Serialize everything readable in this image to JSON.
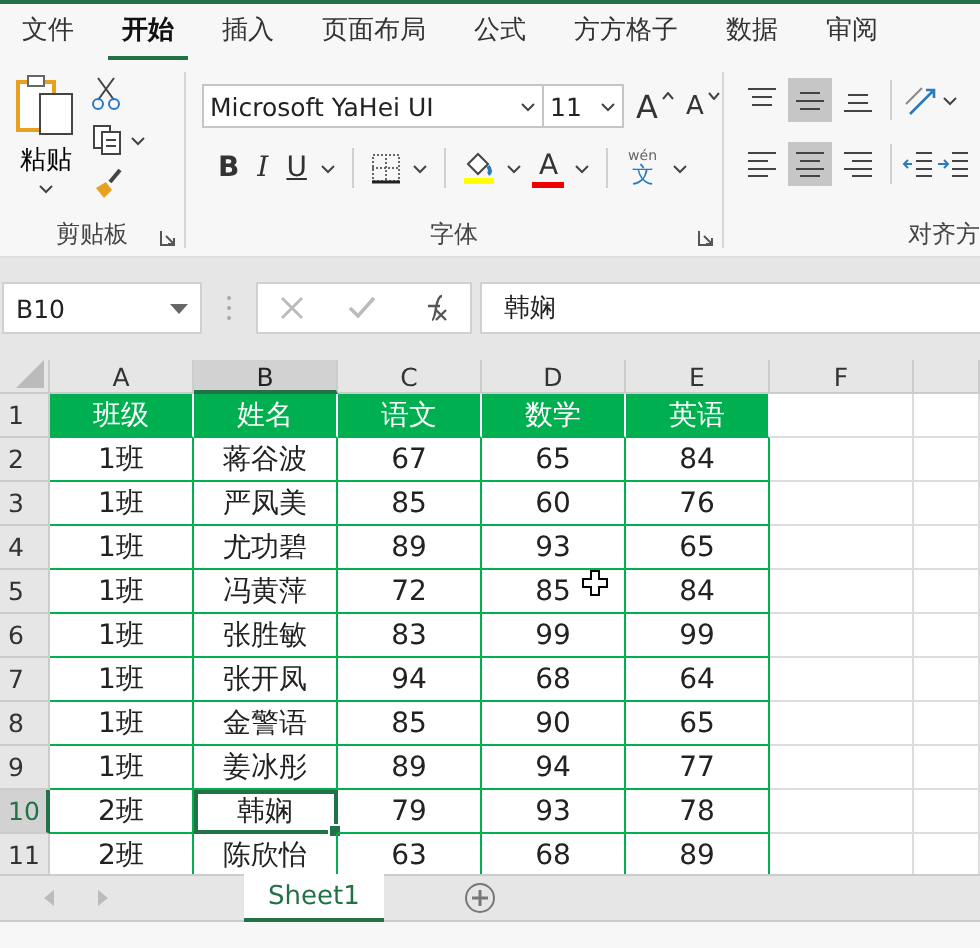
{
  "tabs": [
    {
      "label": "文件",
      "selected": false
    },
    {
      "label": "开始",
      "selected": true
    },
    {
      "label": "插入",
      "selected": false
    },
    {
      "label": "页面布局",
      "selected": false
    },
    {
      "label": "公式",
      "selected": false
    },
    {
      "label": "方方格子",
      "selected": false
    },
    {
      "label": "数据",
      "selected": false
    },
    {
      "label": "审阅",
      "selected": false
    }
  ],
  "clipboard": {
    "paste_label": "粘贴",
    "group_label": "剪贴板"
  },
  "font": {
    "name": "Microsoft YaHei UI",
    "size": "11",
    "grow_label": "A",
    "shrink_label": "A",
    "bold_label": "B",
    "italic_label": "I",
    "underline_label": "U",
    "font_color_label": "A",
    "phonetic_top": "wén",
    "phonetic_main": "文",
    "group_label": "字体"
  },
  "alignment": {
    "group_label": "对齐方",
    "vertical_buttons": [
      {
        "kind": "top",
        "selected": false
      },
      {
        "kind": "middle",
        "selected": true
      },
      {
        "kind": "bottom",
        "selected": false
      }
    ],
    "horizontal_buttons": [
      {
        "kind": "left",
        "selected": false
      },
      {
        "kind": "center",
        "selected": true
      },
      {
        "kind": "right",
        "selected": false
      }
    ]
  },
  "formula_bar": {
    "name_box": "B10",
    "value": "韩娴"
  },
  "sheet": {
    "columns": [
      {
        "label": "A",
        "selected": false
      },
      {
        "label": "B",
        "selected": true
      },
      {
        "label": "C",
        "selected": false
      },
      {
        "label": "D",
        "selected": false
      },
      {
        "label": "E",
        "selected": false
      },
      {
        "label": "F",
        "selected": false
      }
    ],
    "rows": [
      {
        "number": "1",
        "kind": "header",
        "selected": false,
        "cells": [
          "班级",
          "姓名",
          "语文",
          "数学",
          "英语"
        ]
      },
      {
        "number": "2",
        "kind": "data",
        "selected": false,
        "cells": [
          "1班",
          "蒋谷波",
          "67",
          "65",
          "84"
        ]
      },
      {
        "number": "3",
        "kind": "data",
        "selected": false,
        "cells": [
          "1班",
          "严凤美",
          "85",
          "60",
          "76"
        ]
      },
      {
        "number": "4",
        "kind": "data",
        "selected": false,
        "cells": [
          "1班",
          "尤功碧",
          "89",
          "93",
          "65"
        ]
      },
      {
        "number": "5",
        "kind": "data",
        "selected": false,
        "cells": [
          "1班",
          "冯黄萍",
          "72",
          "85",
          "84"
        ]
      },
      {
        "number": "6",
        "kind": "data",
        "selected": false,
        "cells": [
          "1班",
          "张胜敏",
          "83",
          "99",
          "99"
        ]
      },
      {
        "number": "7",
        "kind": "data",
        "selected": false,
        "cells": [
          "1班",
          "张开凤",
          "94",
          "68",
          "64"
        ]
      },
      {
        "number": "8",
        "kind": "data",
        "selected": false,
        "cells": [
          "1班",
          "金警语",
          "85",
          "90",
          "65"
        ]
      },
      {
        "number": "9",
        "kind": "data",
        "selected": false,
        "cells": [
          "1班",
          "姜冰彤",
          "89",
          "94",
          "77"
        ]
      },
      {
        "number": "10",
        "kind": "data",
        "selected": true,
        "cells": [
          "2班",
          "韩娴",
          "79",
          "93",
          "78"
        ]
      },
      {
        "number": "11",
        "kind": "data",
        "selected": false,
        "cells": [
          "2班",
          "陈欣怡",
          "63",
          "68",
          "89"
        ]
      }
    ]
  },
  "sheet_tabs": [
    {
      "label": "Sheet1",
      "selected": true
    }
  ]
}
